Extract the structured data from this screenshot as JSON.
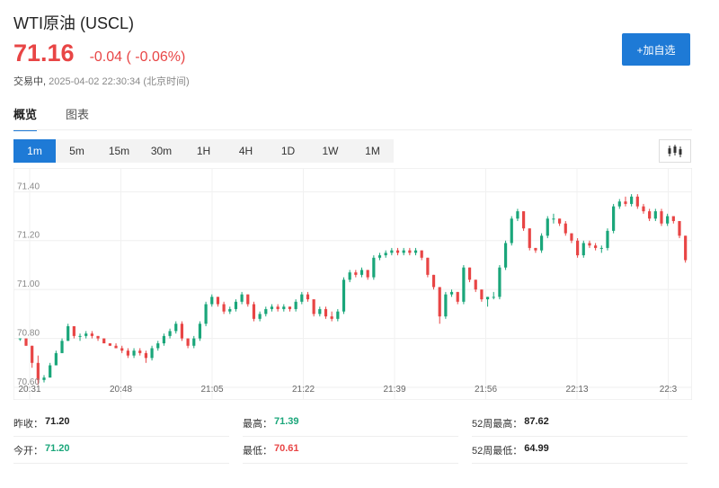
{
  "header": {
    "title": "WTI原油 (USCL)",
    "price": "71.16",
    "change": "-0.04 ( -0.06%)",
    "status_label": "交易中,",
    "timestamp": "2025-04-02 22:30:34 (北京时间)"
  },
  "watch_button": {
    "label": "+加自选"
  },
  "tabs": [
    {
      "label": "概览",
      "active": true
    },
    {
      "label": "图表",
      "active": false
    }
  ],
  "intervals": [
    {
      "label": "1m",
      "active": true
    },
    {
      "label": "5m",
      "active": false
    },
    {
      "label": "15m",
      "active": false
    },
    {
      "label": "30m",
      "active": false
    },
    {
      "label": "1H",
      "active": false
    },
    {
      "label": "4H",
      "active": false
    },
    {
      "label": "1D",
      "active": false
    },
    {
      "label": "1W",
      "active": false
    },
    {
      "label": "1M",
      "active": false
    }
  ],
  "chart_type_icon": "candlestick-icon",
  "colors": {
    "up": "#1aa67a",
    "down": "#e84545",
    "accent": "#1e7ad6"
  },
  "chart_data": {
    "type": "candlestick",
    "ylim": [
      70.6,
      71.46
    ],
    "yticks": [
      70.6,
      70.8,
      71.0,
      71.2,
      71.4
    ],
    "ytick_labels": [
      "70.60",
      "70.80",
      "71.00",
      "71.20",
      "71.40"
    ],
    "xtick_labels": [
      "20:31",
      "20:48",
      "21:05",
      "21:22",
      "21:39",
      "21:56",
      "22:13",
      "22:3"
    ],
    "grid": true,
    "candles": [
      [
        70.8,
        70.8,
        70.79,
        70.8
      ],
      [
        70.8,
        70.8,
        70.77,
        70.77
      ],
      [
        70.77,
        70.77,
        70.68,
        70.7
      ],
      [
        70.7,
        70.73,
        70.61,
        70.63
      ],
      [
        70.63,
        70.65,
        70.62,
        70.64
      ],
      [
        70.64,
        70.7,
        70.64,
        70.69
      ],
      [
        70.69,
        70.75,
        70.69,
        70.74
      ],
      [
        70.74,
        70.8,
        70.74,
        70.79
      ],
      [
        70.79,
        70.86,
        70.79,
        70.85
      ],
      [
        70.85,
        70.85,
        70.8,
        70.81
      ],
      [
        70.81,
        70.82,
        70.79,
        70.81
      ],
      [
        70.81,
        70.83,
        70.8,
        70.82
      ],
      [
        70.82,
        70.83,
        70.8,
        70.81
      ],
      [
        70.81,
        70.81,
        70.79,
        70.8
      ],
      [
        70.8,
        70.8,
        70.78,
        70.78
      ],
      [
        70.78,
        70.78,
        70.77,
        70.77
      ],
      [
        70.77,
        70.78,
        70.76,
        70.76
      ],
      [
        70.76,
        70.77,
        70.74,
        70.75
      ],
      [
        70.75,
        70.76,
        70.72,
        70.73
      ],
      [
        70.73,
        70.76,
        70.72,
        70.75
      ],
      [
        70.75,
        70.76,
        70.73,
        70.74
      ],
      [
        70.74,
        70.75,
        70.7,
        70.72
      ],
      [
        70.72,
        70.77,
        70.71,
        70.76
      ],
      [
        70.76,
        70.79,
        70.75,
        70.78
      ],
      [
        70.78,
        70.82,
        70.77,
        70.81
      ],
      [
        70.81,
        70.84,
        70.8,
        70.83
      ],
      [
        70.83,
        70.87,
        70.82,
        70.86
      ],
      [
        70.86,
        70.87,
        70.79,
        70.8
      ],
      [
        70.8,
        70.8,
        70.76,
        70.77
      ],
      [
        70.77,
        70.81,
        70.76,
        70.8
      ],
      [
        70.8,
        70.87,
        70.79,
        70.86
      ],
      [
        70.86,
        70.95,
        70.85,
        70.94
      ],
      [
        70.94,
        70.98,
        70.93,
        70.97
      ],
      [
        70.97,
        70.97,
        70.93,
        70.94
      ],
      [
        70.94,
        70.95,
        70.9,
        70.91
      ],
      [
        70.91,
        70.93,
        70.9,
        70.92
      ],
      [
        70.92,
        70.96,
        70.91,
        70.95
      ],
      [
        70.95,
        70.99,
        70.94,
        70.98
      ],
      [
        70.98,
        70.98,
        70.93,
        70.94
      ],
      [
        70.94,
        70.95,
        70.87,
        70.88
      ],
      [
        70.88,
        70.91,
        70.87,
        70.9
      ],
      [
        70.9,
        70.93,
        70.89,
        70.92
      ],
      [
        70.92,
        70.94,
        70.91,
        70.93
      ],
      [
        70.93,
        70.94,
        70.91,
        70.92
      ],
      [
        70.92,
        70.94,
        70.91,
        70.93
      ],
      [
        70.93,
        70.93,
        70.91,
        70.92
      ],
      [
        70.92,
        70.96,
        70.91,
        70.95
      ],
      [
        70.95,
        70.99,
        70.94,
        70.98
      ],
      [
        70.98,
        70.99,
        70.95,
        70.96
      ],
      [
        70.96,
        70.96,
        70.89,
        70.9
      ],
      [
        70.9,
        70.93,
        70.89,
        70.92
      ],
      [
        70.92,
        70.93,
        70.88,
        70.89
      ],
      [
        70.89,
        70.91,
        70.87,
        70.88
      ],
      [
        70.88,
        70.92,
        70.87,
        70.91
      ],
      [
        70.91,
        71.05,
        70.9,
        71.04
      ],
      [
        71.04,
        71.08,
        71.03,
        71.07
      ],
      [
        71.07,
        71.08,
        71.05,
        71.06
      ],
      [
        71.06,
        71.09,
        71.05,
        71.08
      ],
      [
        71.08,
        71.08,
        71.04,
        71.05
      ],
      [
        71.05,
        71.14,
        71.04,
        71.13
      ],
      [
        71.13,
        71.15,
        71.12,
        71.14
      ],
      [
        71.14,
        71.16,
        71.13,
        71.15
      ],
      [
        71.15,
        71.17,
        71.14,
        71.16
      ],
      [
        71.16,
        71.17,
        71.14,
        71.15
      ],
      [
        71.15,
        71.17,
        71.14,
        71.16
      ],
      [
        71.16,
        71.17,
        71.14,
        71.15
      ],
      [
        71.15,
        71.17,
        71.14,
        71.16
      ],
      [
        71.16,
        71.16,
        71.12,
        71.13
      ],
      [
        71.13,
        71.13,
        71.05,
        71.06
      ],
      [
        71.06,
        71.06,
        71.0,
        71.01
      ],
      [
        71.01,
        71.01,
        70.86,
        70.89
      ],
      [
        70.89,
        70.99,
        70.88,
        70.98
      ],
      [
        70.98,
        71.0,
        70.97,
        70.99
      ],
      [
        70.99,
        70.99,
        70.94,
        70.95
      ],
      [
        70.95,
        71.1,
        70.94,
        71.09
      ],
      [
        71.09,
        71.09,
        71.03,
        71.04
      ],
      [
        71.04,
        71.04,
        70.99,
        71.0
      ],
      [
        71.0,
        71.0,
        70.95,
        70.96
      ],
      [
        70.96,
        70.97,
        70.93,
        70.97
      ],
      [
        70.97,
        70.99,
        70.96,
        70.97
      ],
      [
        70.97,
        71.1,
        70.96,
        71.09
      ],
      [
        71.09,
        71.2,
        71.08,
        71.19
      ],
      [
        71.19,
        71.3,
        71.18,
        71.29
      ],
      [
        71.29,
        71.33,
        71.28,
        71.32
      ],
      [
        71.32,
        71.32,
        71.24,
        71.25
      ],
      [
        71.25,
        71.25,
        71.16,
        71.17
      ],
      [
        71.17,
        71.17,
        71.15,
        71.16
      ],
      [
        71.16,
        71.23,
        71.15,
        71.22
      ],
      [
        71.22,
        71.3,
        71.21,
        71.29
      ],
      [
        71.29,
        71.31,
        71.27,
        71.29
      ],
      [
        71.29,
        71.29,
        71.26,
        71.27
      ],
      [
        71.27,
        71.28,
        71.22,
        71.23
      ],
      [
        71.23,
        71.23,
        71.19,
        71.2
      ],
      [
        71.2,
        71.21,
        71.13,
        71.14
      ],
      [
        71.14,
        71.2,
        71.13,
        71.19
      ],
      [
        71.19,
        71.2,
        71.17,
        71.18
      ],
      [
        71.18,
        71.19,
        71.16,
        71.17
      ],
      [
        71.17,
        71.18,
        71.15,
        71.17
      ],
      [
        71.17,
        71.25,
        71.16,
        71.24
      ],
      [
        71.24,
        71.35,
        71.23,
        71.34
      ],
      [
        71.34,
        71.37,
        71.33,
        71.36
      ],
      [
        71.36,
        71.38,
        71.34,
        71.35
      ],
      [
        71.35,
        71.39,
        71.34,
        71.38
      ],
      [
        71.38,
        71.39,
        71.33,
        71.34
      ],
      [
        71.34,
        71.35,
        71.31,
        71.32
      ],
      [
        71.32,
        71.33,
        71.28,
        71.29
      ],
      [
        71.29,
        71.33,
        71.28,
        71.32
      ],
      [
        71.32,
        71.33,
        71.26,
        71.27
      ],
      [
        71.27,
        71.31,
        71.26,
        71.3
      ],
      [
        71.3,
        71.3,
        71.27,
        71.28
      ],
      [
        71.28,
        71.28,
        71.21,
        71.22
      ],
      [
        71.22,
        71.22,
        71.11,
        71.12
      ]
    ]
  },
  "stats": {
    "prev_close": {
      "label": "昨收：",
      "value": "71.20"
    },
    "open": {
      "label": "今开：",
      "value": "71.20"
    },
    "high": {
      "label": "最高：",
      "value": "71.39"
    },
    "low": {
      "label": "最低：",
      "value": "70.61"
    },
    "wk52_high": {
      "label": "52周最高：",
      "value": "87.62"
    },
    "wk52_low": {
      "label": "52周最低：",
      "value": "64.99"
    }
  }
}
